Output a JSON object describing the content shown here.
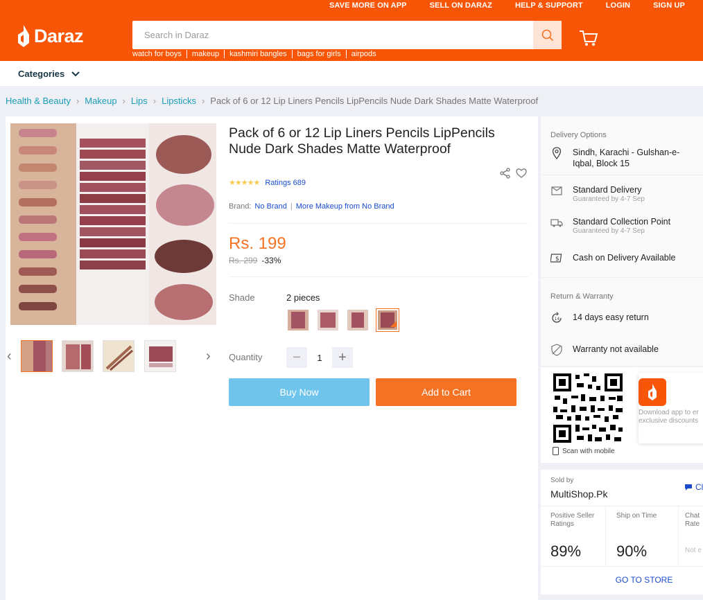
{
  "header": {
    "top_links": [
      "SAVE MORE ON APP",
      "SELL ON DARAZ",
      "HELP & SUPPORT",
      "LOGIN",
      "SIGN UP"
    ],
    "logo_text": "Daraz",
    "search_placeholder": "Search in Daraz",
    "hot_words": [
      "watch for boys",
      "makeup",
      "kashmiri bangles",
      "bags for girls",
      "airpods"
    ],
    "brand_color": "#f85606"
  },
  "nav": {
    "categories_label": "Categories"
  },
  "breadcrumb": [
    "Health & Beauty",
    "Makeup",
    "Lips",
    "Lipsticks"
  ],
  "breadcrumb_current": "Pack of 6 or 12 Lip Liners Pencils LipPencils Nude Dark Shades Matte Waterproof",
  "product": {
    "title": "Pack of 6 or 12 Lip Liners Pencils LipPencils Nude Dark Shades Matte Waterproof",
    "stars": "★★★★★",
    "rating_value": 4.5,
    "ratings_label": "Ratings 689",
    "brand_label": "Brand:",
    "brand_name": "No Brand",
    "brand_more": "More Makeup from No Brand",
    "price": "Rs. 199",
    "old_price": "Rs. 299",
    "discount": "-33%",
    "shade_label": "Shade",
    "shade_value": "2 pieces",
    "quantity_label": "Quantity",
    "quantity": "1",
    "qty_minus": "−",
    "qty_plus": "+",
    "buy_now": "Buy Now",
    "add_to_cart": "Add to Cart"
  },
  "delivery": {
    "title": "Delivery Options",
    "location": "Sindh, Karachi - Gulshan-e-Iqbal, Block 15",
    "standard": "Standard Delivery",
    "standard_sub": "Guaranteed by 4-7 Sep",
    "collection": "Standard Collection Point",
    "collection_sub": "Guaranteed by 4-7 Sep",
    "cod": "Cash on Delivery Available"
  },
  "returns": {
    "title": "Return & Warranty",
    "return_text": "14 days easy return",
    "warranty_text": "Warranty not available"
  },
  "app": {
    "scan_label": "Scan with mobile",
    "download_text": "Download app to er exclusive discounts"
  },
  "seller": {
    "sold_by_label": "Sold by",
    "name": "MultiShop.Pk",
    "chat_label": "Cl",
    "positive_label": "Positive Seller Ratings",
    "positive_value": "89%",
    "ship_label": "Ship on Time",
    "ship_value": "90%",
    "chat_rate_label": "Chat Rate",
    "chat_rate_value": "Not e",
    "go_store": "GO TO STORE"
  }
}
